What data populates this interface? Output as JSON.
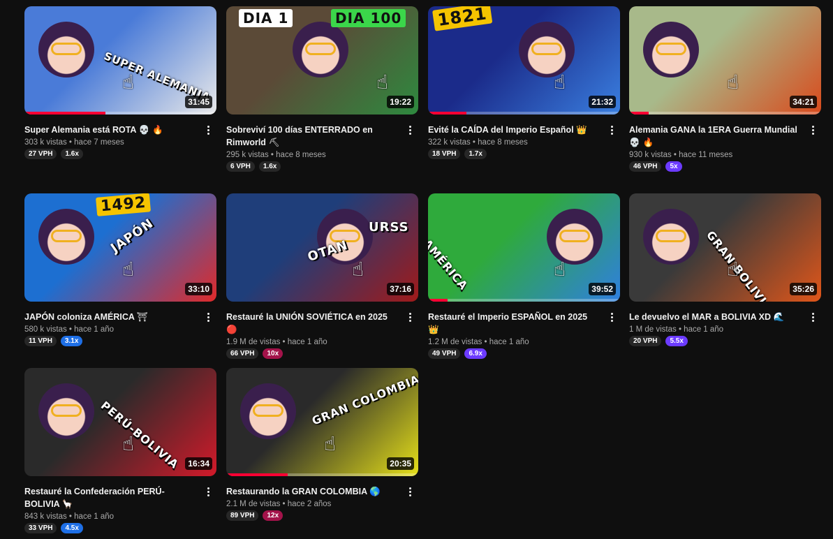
{
  "videos": [
    {
      "title": "Super Alemania está ROTA",
      "emoji": "💀 🔥",
      "views": "303 k vistas",
      "age": "hace 7 meses",
      "vph": "27 VPH",
      "ratio": "1.6x",
      "ratio_color": "#272727",
      "duration": "31:45",
      "progress": 0.42,
      "thumb_text": [
        "SUPER ALEMANIA"
      ],
      "colors": [
        "#4a7bd8",
        "#e9e9e9"
      ]
    },
    {
      "title": "Sobreviví 100 días ENTERRADO en Rimworld",
      "emoji": "⛏",
      "views": "295 k vistas",
      "age": "hace 8 meses",
      "vph": "6 VPH",
      "ratio": "1.6x",
      "ratio_color": "#272727",
      "duration": "19:22",
      "progress": 0.0,
      "thumb_text": [
        "DIA 1",
        "DIA 100"
      ],
      "colors": [
        "#5b4a37",
        "#2e8a3f"
      ]
    },
    {
      "title": "Evité la CAÍDA del Imperio Español",
      "emoji": "👑",
      "views": "322 k vistas",
      "age": "hace 8 meses",
      "vph": "18 VPH",
      "ratio": "1.7x",
      "ratio_color": "#272727",
      "duration": "21:32",
      "progress": 0.2,
      "thumb_text": [
        "1821"
      ],
      "colors": [
        "#1b2b8a",
        "#3a7fe0"
      ]
    },
    {
      "title": "Alemania GANA la 1ERA Guerra Mundial",
      "emoji": "💀 🔥",
      "views": "930 k vistas",
      "age": "hace 11 meses",
      "vph": "46 VPH",
      "ratio": "5x",
      "ratio_color": "#6c3bff",
      "duration": "34:21",
      "progress": 0.1,
      "thumb_text": [],
      "colors": [
        "#a8b98a",
        "#d94a1c"
      ]
    },
    {
      "title": "JAPÓN coloniza AMÉRICA",
      "emoji": "⛩",
      "views": "580 k vistas",
      "age": "hace 1 año",
      "vph": "11 VPH",
      "ratio": "3.1x",
      "ratio_color": "#1e6fe6",
      "duration": "33:10",
      "progress": 0.0,
      "thumb_text": [
        "1492",
        "JAPÓN"
      ],
      "colors": [
        "#1d6fd1",
        "#e02a2a"
      ]
    },
    {
      "title": "Restauré la UNIÓN SOVIÉTICA en 2025",
      "emoji": "🔴",
      "views": "1.9 M de vistas",
      "age": "hace 1 año",
      "vph": "66 VPH",
      "ratio": "10x",
      "ratio_color": "#a3134a",
      "duration": "37:16",
      "progress": 0.0,
      "thumb_text": [
        "URSS",
        "OTAN"
      ],
      "colors": [
        "#1f3e7a",
        "#a01a1a"
      ]
    },
    {
      "title": "Restauré el Imperio ESPAÑOL en 2025",
      "emoji": "👑",
      "views": "1.2 M de vistas",
      "age": "hace 1 año",
      "vph": "49 VPH",
      "ratio": "6.9x",
      "ratio_color": "#6c3bff",
      "duration": "39:52",
      "progress": 0.1,
      "thumb_text": [
        "AMÉRICA"
      ],
      "colors": [
        "#2faa3c",
        "#2f7fe0"
      ]
    },
    {
      "title": "Le devuelvo el MAR a BOLIVIA XD",
      "emoji": "🌊",
      "views": "1 M de vistas",
      "age": "hace 1 año",
      "vph": "20 VPH",
      "ratio": "5.5x",
      "ratio_color": "#6c3bff",
      "duration": "35:26",
      "progress": 0.0,
      "thumb_text": [
        "GRAN BOLIVIA"
      ],
      "colors": [
        "#3a3a3a",
        "#e0561a"
      ]
    },
    {
      "title": "Restauré la Confederación PERÚ-BOLIVIA",
      "emoji": "🦙",
      "views": "843 k vistas",
      "age": "hace 1 año",
      "vph": "33 VPH",
      "ratio": "4.5x",
      "ratio_color": "#1e6fe6",
      "duration": "16:34",
      "progress": 0.0,
      "thumb_text": [
        "PERÚ-BOLIVIA"
      ],
      "colors": [
        "#2a2a2a",
        "#d21a2a"
      ]
    },
    {
      "title": "Restaurando la GRAN COLOMBIA",
      "emoji": "🌎",
      "views": "2.1 M de vistas",
      "age": "hace 2 años",
      "vph": "89 VPH",
      "ratio": "12x",
      "ratio_color": "#a3134a",
      "duration": "20:35",
      "progress": 0.32,
      "thumb_text": [
        "GRAN COLOMBIA"
      ],
      "colors": [
        "#2a2a2a",
        "#e6e01a"
      ]
    }
  ]
}
